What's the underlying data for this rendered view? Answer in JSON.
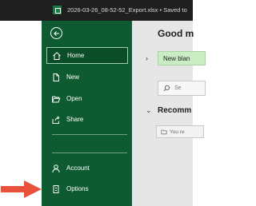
{
  "window": {
    "title": "2026-03-26_08-52-52_Export.xlsx • Saved to"
  },
  "backstage": {
    "nav": [
      {
        "label": "Home",
        "icon": "home-icon",
        "active": true
      },
      {
        "label": "New",
        "icon": "new-file-icon"
      },
      {
        "label": "Open",
        "icon": "folder-open-icon"
      },
      {
        "label": "Share",
        "icon": "share-icon"
      }
    ],
    "bottom_nav": [
      {
        "label": "Account",
        "icon": "person-icon"
      },
      {
        "label": "Options",
        "icon": "options-icon"
      }
    ]
  },
  "home": {
    "greeting": "Good m",
    "new_blank_label": "New blan",
    "search_placeholder": "Se",
    "recommended_heading": "Recomm",
    "recommended_card_text": "You re"
  },
  "colors": {
    "titlebar_bg": "#1f1f1f",
    "backstage_bg": "#0e5a31",
    "accent_green": "#1d7a45",
    "pointer_arrow": "#e8513a"
  }
}
